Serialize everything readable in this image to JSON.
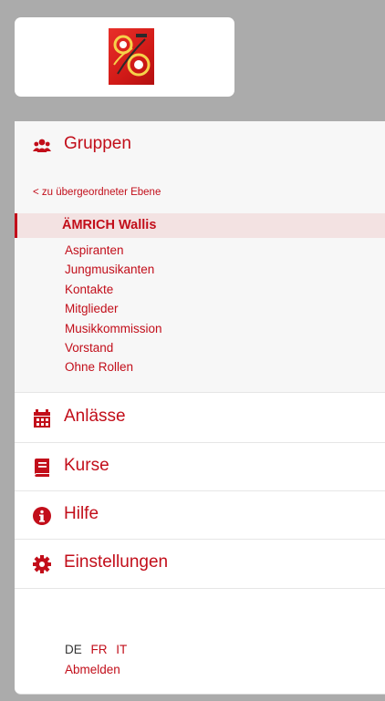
{
  "header": {
    "logo_icon": "brass-band-logo"
  },
  "navigation": {
    "groups": {
      "label": "Gruppen",
      "icon": "users-icon",
      "back_link": "< zu übergeordneter Ebene",
      "current": "ÄMRICH Wallis",
      "items": [
        {
          "label": "Aspiranten"
        },
        {
          "label": "Jungmusikanten"
        },
        {
          "label": "Kontakte"
        },
        {
          "label": "Mitglieder"
        },
        {
          "label": "Musikkommission"
        },
        {
          "label": "Vorstand"
        },
        {
          "label": "Ohne Rollen"
        }
      ]
    },
    "events": {
      "label": "Anlässe",
      "icon": "calendar-icon"
    },
    "courses": {
      "label": "Kurse",
      "icon": "book-icon"
    },
    "help": {
      "label": "Hilfe",
      "icon": "info-icon"
    },
    "settings": {
      "label": "Einstellungen",
      "icon": "gear-icon"
    }
  },
  "footer": {
    "languages": [
      {
        "code": "DE",
        "active": true
      },
      {
        "code": "FR",
        "active": false
      },
      {
        "code": "IT",
        "active": false
      }
    ],
    "logout_label": "Abmelden"
  },
  "colors": {
    "accent": "#c20e1a",
    "current_bg": "#f3e2e2",
    "page_bg": "#ababab"
  }
}
